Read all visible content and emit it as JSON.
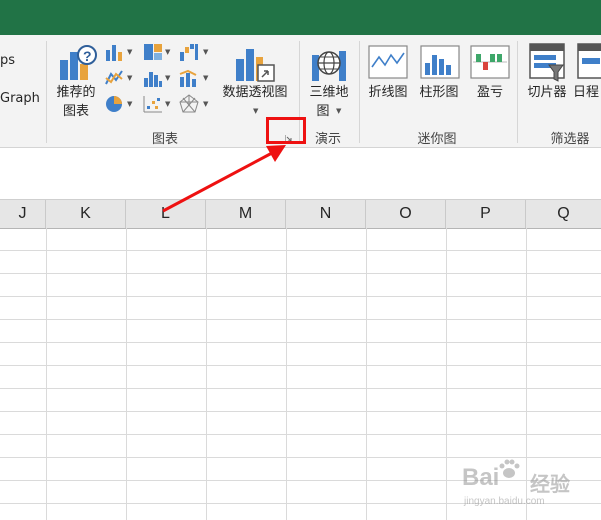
{
  "ribbon": {
    "left_partial": {
      "top_text": "ps",
      "bottom_text": "Graph"
    },
    "recommended_charts": {
      "line1": "推荐的",
      "line2": "图表"
    },
    "pivot_chart": {
      "label": "数据透视图"
    },
    "map3d": {
      "line1": "三维地",
      "line2": "图"
    },
    "sparkline_line": {
      "label": "折线图"
    },
    "sparkline_column": {
      "label": "柱形图"
    },
    "sparkline_winloss": {
      "label": "盈亏"
    },
    "slicer": {
      "label": "切片器"
    },
    "timeline": {
      "label": "日程"
    },
    "groups": {
      "charts": "图表",
      "tours": "演示",
      "sparklines": "迷你图",
      "filters": "筛选器"
    },
    "small_chart_icons": [
      "column-chart-icon",
      "hierarchy-chart-icon",
      "waterfall-chart-icon",
      "line-chart-icon",
      "statistic-chart-icon",
      "combo-chart-icon",
      "pie-chart-icon",
      "scatter-chart-icon",
      "radar-chart-icon"
    ]
  },
  "sheet": {
    "columns": [
      "J",
      "K",
      "L",
      "M",
      "N",
      "O",
      "P",
      "Q"
    ]
  },
  "annotation": {
    "color": "#ee1111"
  },
  "watermark": {
    "main": "Bai",
    "sub": "经验",
    "url": "jingyan.baidu.com"
  },
  "colors": {
    "title_bar": "#217346",
    "ribbon": "#f3f3f3",
    "header": "#e6e6e6"
  }
}
